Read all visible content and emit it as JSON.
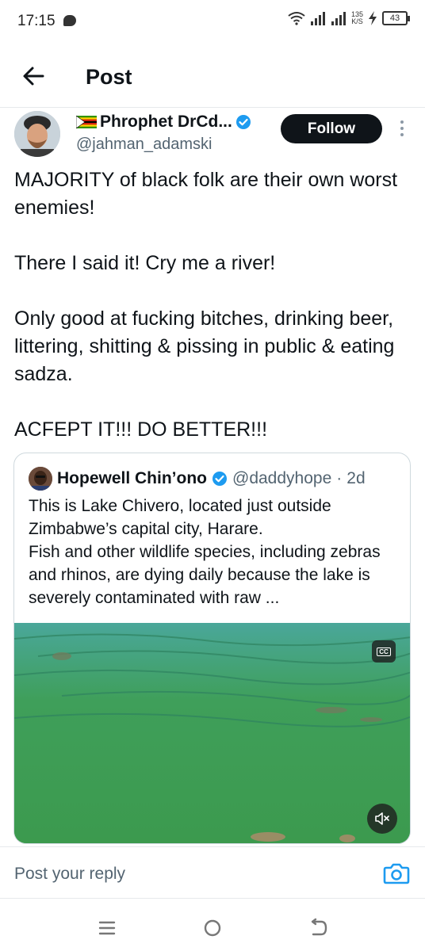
{
  "status_bar": {
    "time": "17:15",
    "net_speed": "135",
    "net_unit": "K/S",
    "battery": "43",
    "icons": [
      "chat-bubble-icon",
      "wifi-icon",
      "signal-icon",
      "signal-icon",
      "charging-icon",
      "battery-icon"
    ]
  },
  "header": {
    "title": "Post",
    "back_icon": "arrow-left-icon"
  },
  "author": {
    "display_name": "Phrophet DrCd...",
    "handle": "@jahman_adamski",
    "flag": "zimbabwe-flag-icon",
    "verified": true,
    "follow_label": "Follow"
  },
  "post": {
    "paragraphs": [
      "MAJORITY of black folk are their own worst enemies!",
      "There I said it! Cry me a river!",
      "Only good at fucking bitches, drinking beer, littering, shitting & pissing in public & eating sadza.",
      "ACFEPT IT!!! DO BETTER!!!"
    ]
  },
  "quoted_post": {
    "display_name": "Hopewell Chin’ono",
    "handle": "@daddyhope",
    "separator": "·",
    "time": "2d",
    "verified": true,
    "text_lines": [
      "This is Lake Chivero, located just outside Zimbabwe’s capital city, Harare.",
      "Fish and other wildlife species, including zebras and rhinos, are dying daily because the lake is severely contaminated with raw ..."
    ],
    "media": {
      "type": "video",
      "cc_label": "CC",
      "muted": true
    }
  },
  "reply": {
    "placeholder": "Post your reply",
    "camera_icon": "camera-icon"
  },
  "nav": {
    "icons": [
      "menu-icon",
      "home-circle-icon",
      "back-icon"
    ]
  },
  "colors": {
    "accent": "#1d9bf0",
    "text": "#0f1419",
    "secondary_text": "#536471",
    "border": "#cfd9de",
    "follow_bg": "#0f1419",
    "lake_green": "#3f9b53"
  }
}
